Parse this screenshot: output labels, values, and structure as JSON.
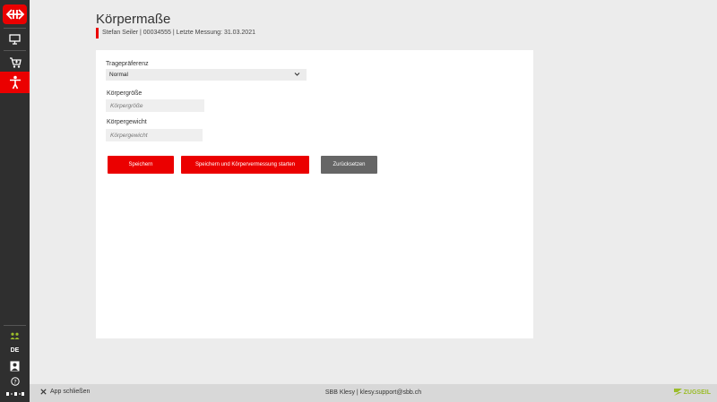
{
  "app": {
    "name": "SBB Klesy"
  },
  "sidebar": {
    "logo_icon": "sbb-logo-icon",
    "items": [
      {
        "icon": "monitor-icon",
        "active": false
      },
      {
        "icon": "cart-icon",
        "active": false
      },
      {
        "icon": "person-measure-icon",
        "active": true
      }
    ],
    "bottom": {
      "users_icon": "users-icon",
      "language": "DE",
      "profile_icon": "profile-icon",
      "help_icon": "help-icon",
      "bmp_icon": "bmp-icon"
    }
  },
  "header": {
    "title": "Körpermaße",
    "subtitle": "Stefan Seiler | 00034555 | Letzte Messung: 31.03.2021"
  },
  "form": {
    "tragepraeferenz": {
      "label": "Tragepräferenz",
      "value": "Normal"
    },
    "koerpergroesse": {
      "label": "Körpergröße",
      "value": "",
      "placeholder": "Körpergröße"
    },
    "koerpergewicht": {
      "label": "Körpergewicht",
      "value": "",
      "placeholder": "Körpergewicht"
    }
  },
  "buttons": {
    "save": "Speichern",
    "save_and_measure": "Speichern und Körpervermessung starten",
    "reset": "Zurücksetzen"
  },
  "footer": {
    "close_app": "App schließen",
    "center": "SBB Klesy | klesy.support@sbb.ch",
    "brand": "ZUGSEIL"
  },
  "colors": {
    "accent": "#eb0000",
    "sidebar": "#2f2f2f",
    "secondary_button": "#666666",
    "brand_green": "#9bbc2a"
  }
}
